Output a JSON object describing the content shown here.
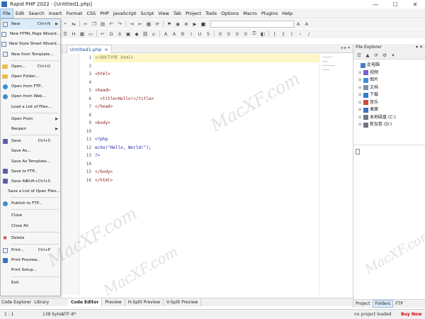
{
  "window": {
    "title": "Rapid PHP 2022 - [Untitled1.php]",
    "minimize": "—",
    "maximize": "☐",
    "close": "✕"
  },
  "menubar": {
    "items": [
      "File",
      "Edit",
      "Search",
      "Insert",
      "Format",
      "CSS",
      "PHP",
      "JavaScript",
      "Script",
      "View",
      "Tab",
      "Project",
      "Tools",
      "Options",
      "Macro",
      "Plugins",
      "Help"
    ]
  },
  "file_menu": {
    "items": [
      {
        "label": "New",
        "shortcut": "Ctrl+N",
        "arrow": "▶",
        "icon": "new-file-icon"
      },
      {
        "label": "New HTML Page Wizard...",
        "icon": "html-wizard-icon"
      },
      {
        "label": "New Style Sheet Wizard...",
        "icon": "css-wizard-icon"
      },
      {
        "label": "New from Template...",
        "icon": "template-icon"
      },
      {
        "label": "Open...",
        "shortcut": "Ctrl+O",
        "icon": "open-folder-icon"
      },
      {
        "label": "Open Folder...",
        "icon": "folder-icon"
      },
      {
        "label": "Open from FTP...",
        "icon": "ftp-icon"
      },
      {
        "label": "Open from Web...",
        "icon": "globe-icon"
      },
      {
        "label": "Load a List of Files...",
        "icon": ""
      },
      {
        "label": "Open From",
        "arrow": "▶",
        "icon": ""
      },
      {
        "label": "Reopen",
        "arrow": "▶",
        "icon": ""
      },
      {
        "label": "Save",
        "shortcut": "Ctrl+S",
        "icon": "save-icon"
      },
      {
        "label": "Save As...",
        "icon": ""
      },
      {
        "label": "Save As Template...",
        "icon": ""
      },
      {
        "label": "Save to FTP...",
        "icon": "save-ftp-icon"
      },
      {
        "label": "Save All",
        "shortcut": "Shift+Ctrl+S",
        "icon": "save-all-icon"
      },
      {
        "label": "Save a List of Open Files...",
        "icon": ""
      },
      {
        "label": "Publish to FTP...",
        "icon": "publish-icon"
      },
      {
        "label": "Close",
        "icon": ""
      },
      {
        "label": "Close All",
        "icon": ""
      },
      {
        "label": "Delete",
        "icon": "delete-icon"
      },
      {
        "label": "Print...",
        "shortcut": "Ctrl+P",
        "icon": "print-icon"
      },
      {
        "label": "Print Preview...",
        "icon": "print-preview-icon"
      },
      {
        "label": "Print Setup...",
        "icon": ""
      },
      {
        "label": "Exit",
        "icon": ""
      }
    ]
  },
  "editor": {
    "tab_label": "Untitled1.php",
    "tab_close": "×",
    "tab_nav": "◂ ▸ ▾",
    "line_numbers": [
      "1",
      "2",
      "3",
      "4",
      "5",
      "6",
      "7",
      "8",
      "9",
      "10",
      "11",
      "12",
      "13",
      "14",
      "15",
      "16"
    ],
    "lines": [
      "<!DOCTYPE html>",
      "",
      "<html>",
      "",
      "<head>",
      "  <title>Hello!</title>",
      "</head>",
      "",
      "<body>",
      "",
      "<?php",
      "echo(\"Hello, World!\");",
      "?>",
      "",
      "</body>",
      "</html>"
    ]
  },
  "bottom_tabs": [
    "Code Editor",
    "Preview",
    "H-Split Preview",
    "V-Split Preview"
  ],
  "left_bottom_tabs": [
    "Code Explorer",
    "Library"
  ],
  "file_explorer": {
    "title": "File Explorer",
    "pin": "▾ ✕",
    "tree": [
      {
        "label": "此电脑",
        "level": 0,
        "expander": "",
        "color": "#4a7fc1"
      },
      {
        "label": "视频",
        "level": 1,
        "expander": "⊞",
        "color": "#7b5ec9"
      },
      {
        "label": "图片",
        "level": 1,
        "expander": "⊞",
        "color": "#3a91d6"
      },
      {
        "label": "文档",
        "level": 1,
        "expander": "⊞",
        "color": "#7a8fa6"
      },
      {
        "label": "下载",
        "level": 1,
        "expander": "⊞",
        "color": "#2d7fd1"
      },
      {
        "label": "音乐",
        "level": 1,
        "expander": "⊞",
        "color": "#d04a39"
      },
      {
        "label": "桌面",
        "level": 1,
        "expander": "⊞",
        "color": "#3a72c0"
      },
      {
        "label": "本地磁盘 (C:)",
        "level": 1,
        "expander": "⊞",
        "color": "#6f7680"
      },
      {
        "label": "新加卷 (D:)",
        "level": 1,
        "expander": "⊞",
        "color": "#6f7680"
      }
    ],
    "bottom_tabs": [
      "Project",
      "Folders",
      "FTP"
    ]
  },
  "status": {
    "position": "1 : 1",
    "size": "138 bytes",
    "encoding": "UTF-8*",
    "project": "no project loaded",
    "buy": "Buy Now"
  },
  "watermark": "MacXF.com"
}
